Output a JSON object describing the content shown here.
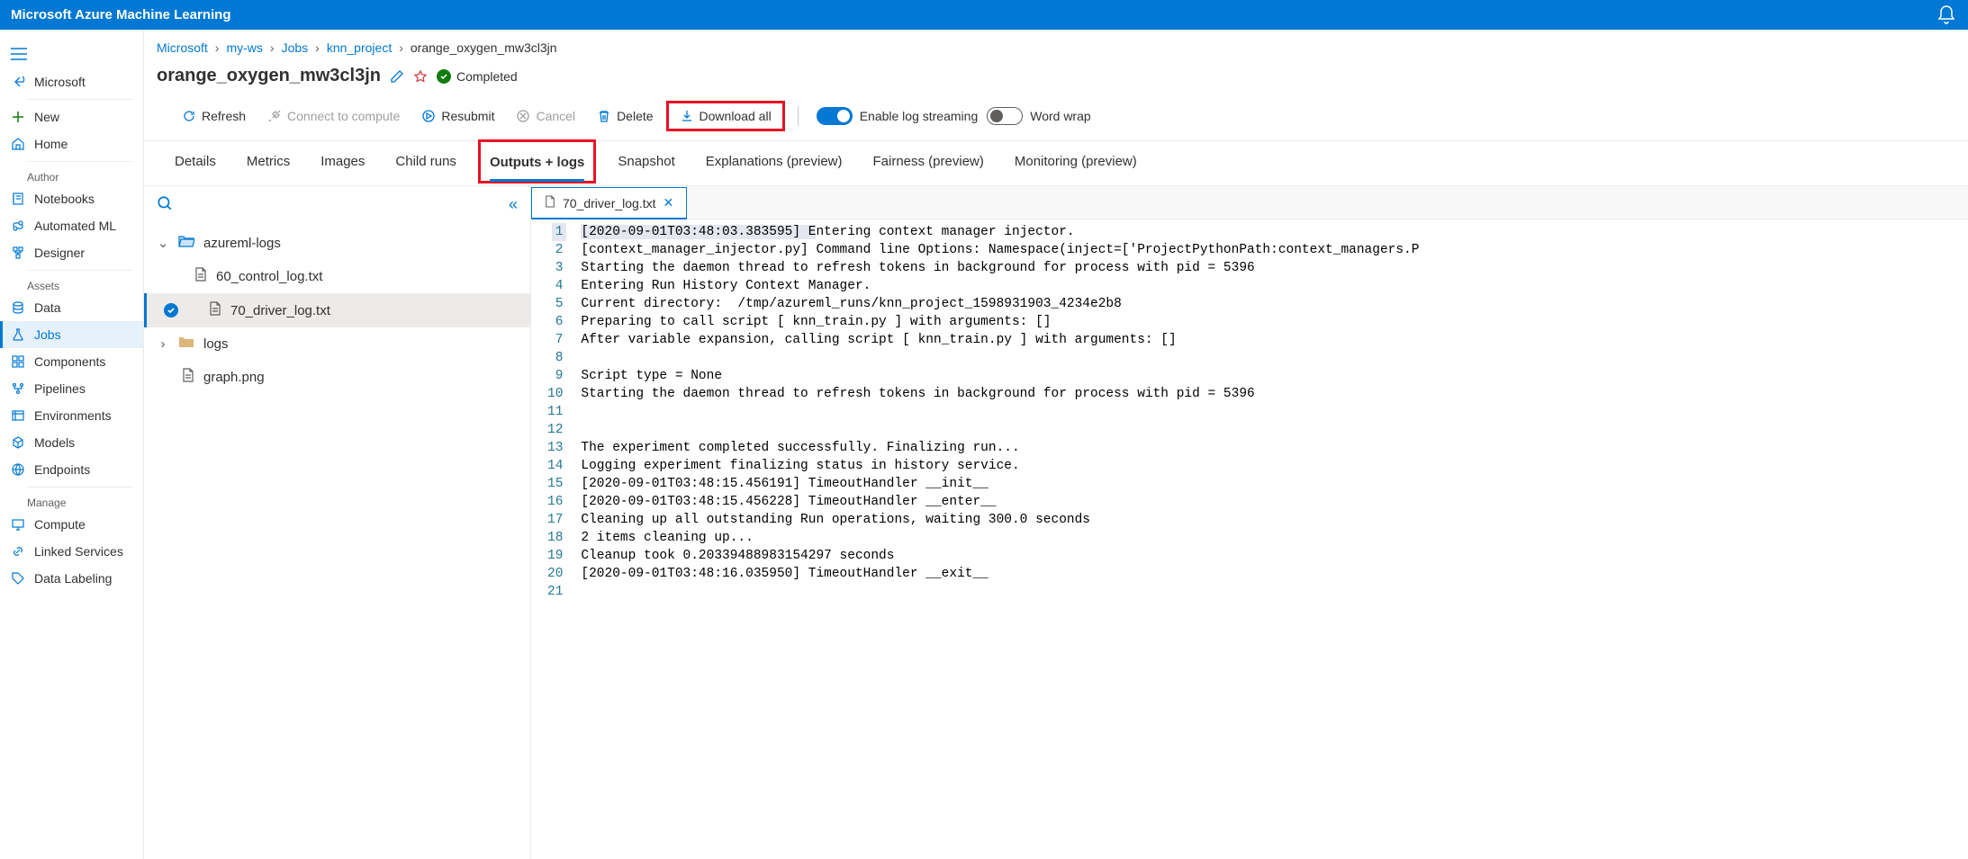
{
  "topbar": {
    "title": "Microsoft Azure Machine Learning"
  },
  "leftnav": {
    "back_label": "Microsoft",
    "items_top": [
      {
        "icon": "plus",
        "label": "New"
      },
      {
        "icon": "home",
        "label": "Home"
      }
    ],
    "section_author": "Author",
    "items_author": [
      {
        "icon": "notebook",
        "label": "Notebooks"
      },
      {
        "icon": "auto",
        "label": "Automated ML"
      },
      {
        "icon": "designer",
        "label": "Designer"
      }
    ],
    "section_assets": "Assets",
    "items_assets": [
      {
        "icon": "data",
        "label": "Data"
      },
      {
        "icon": "jobs",
        "label": "Jobs",
        "selected": true
      },
      {
        "icon": "components",
        "label": "Components"
      },
      {
        "icon": "pipelines",
        "label": "Pipelines"
      },
      {
        "icon": "env",
        "label": "Environments"
      },
      {
        "icon": "models",
        "label": "Models"
      },
      {
        "icon": "endpoints",
        "label": "Endpoints"
      }
    ],
    "section_manage": "Manage",
    "items_manage": [
      {
        "icon": "compute",
        "label": "Compute"
      },
      {
        "icon": "linked",
        "label": "Linked Services"
      },
      {
        "icon": "labeling",
        "label": "Data Labeling"
      }
    ]
  },
  "breadcrumb": {
    "parts": [
      "Microsoft",
      "my-ws",
      "Jobs",
      "knn_project"
    ],
    "current": "orange_oxygen_mw3cl3jn"
  },
  "title": {
    "name": "orange_oxygen_mw3cl3jn",
    "status": "Completed"
  },
  "toolbar": {
    "refresh": "Refresh",
    "connect": "Connect to compute",
    "resubmit": "Resubmit",
    "cancel": "Cancel",
    "delete": "Delete",
    "download": "Download all",
    "log_stream": "Enable log streaming",
    "word_wrap": "Word wrap"
  },
  "tabs": {
    "items": [
      "Details",
      "Metrics",
      "Images",
      "Child runs",
      "Outputs + logs",
      "Snapshot",
      "Explanations (preview)",
      "Fairness (preview)",
      "Monitoring (preview)"
    ],
    "active": "Outputs + logs"
  },
  "tree": {
    "root1": "azureml-logs",
    "file1": "60_control_log.txt",
    "file2": "70_driver_log.txt",
    "root2": "logs",
    "file3": "graph.png"
  },
  "editor": {
    "active_file": "70_driver_log.txt",
    "lines": [
      "[2020-09-01T03:48:03.383595] Entering context manager injector.",
      "[context_manager_injector.py] Command line Options: Namespace(inject=['ProjectPythonPath:context_managers.P",
      "Starting the daemon thread to refresh tokens in background for process with pid = 5396",
      "Entering Run History Context Manager.",
      "Current directory:  /tmp/azureml_runs/knn_project_1598931903_4234e2b8",
      "Preparing to call script [ knn_train.py ] with arguments: []",
      "After variable expansion, calling script [ knn_train.py ] with arguments: []",
      "",
      "Script type = None",
      "Starting the daemon thread to refresh tokens in background for process with pid = 5396",
      "",
      "",
      "The experiment completed successfully. Finalizing run...",
      "Logging experiment finalizing status in history service.",
      "[2020-09-01T03:48:15.456191] TimeoutHandler __init__",
      "[2020-09-01T03:48:15.456228] TimeoutHandler __enter__",
      "Cleaning up all outstanding Run operations, waiting 300.0 seconds",
      "2 items cleaning up...",
      "Cleanup took 0.20339488983154297 seconds",
      "[2020-09-01T03:48:16.035950] TimeoutHandler __exit__",
      ""
    ]
  }
}
